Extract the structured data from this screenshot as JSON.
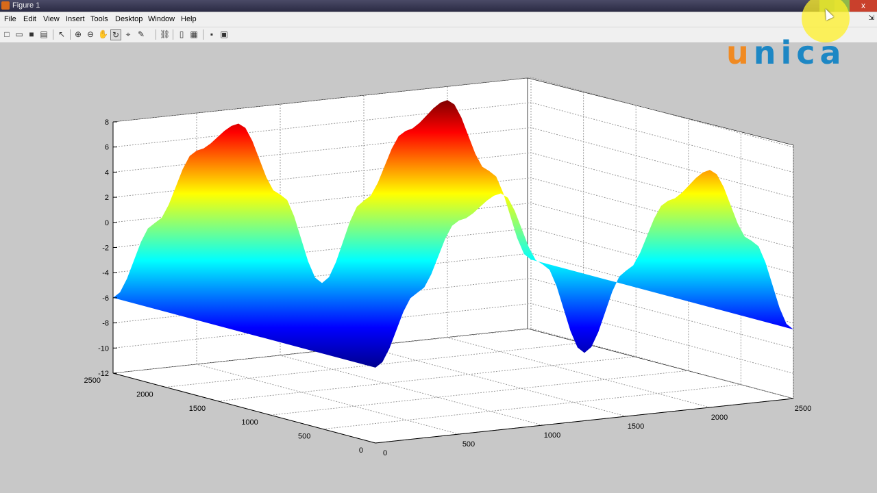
{
  "window": {
    "title": "Figure 1",
    "close_glyph": "x"
  },
  "menu": [
    "File",
    "Edit",
    "View",
    "Insert",
    "Tools",
    "Desktop",
    "Window",
    "Help"
  ],
  "menu_pin": "⇲",
  "toolbar": [
    {
      "icon": "new-figure-icon",
      "glyph": "□"
    },
    {
      "icon": "open-file-icon",
      "glyph": "▭"
    },
    {
      "icon": "save-icon",
      "glyph": "■"
    },
    {
      "icon": "print-icon",
      "glyph": "▤"
    },
    {
      "icon": "edit-plot-arrow-icon",
      "glyph": "↖"
    },
    {
      "icon": "zoom-in-icon",
      "glyph": "⊕"
    },
    {
      "icon": "zoom-out-icon",
      "glyph": "⊖"
    },
    {
      "icon": "pan-hand-icon",
      "glyph": "✋"
    },
    {
      "icon": "rotate-3d-icon",
      "glyph": "↻"
    },
    {
      "icon": "data-cursor-icon",
      "glyph": "⌖"
    },
    {
      "icon": "brush-icon",
      "glyph": "✎"
    },
    {
      "icon": "link-plot-icon",
      "glyph": "⛓"
    },
    {
      "icon": "colorbar-icon",
      "glyph": "▯"
    },
    {
      "icon": "legend-icon",
      "glyph": "▦"
    },
    {
      "icon": "hide-tools-icon",
      "glyph": "▪"
    },
    {
      "icon": "show-tools-icon",
      "glyph": "▣"
    }
  ],
  "logo": {
    "u": "u",
    "rest": "nica"
  },
  "chart_data": {
    "type": "surface",
    "colormap": "jet",
    "function": "z varies sinusoidally along x, constant along y",
    "x": [
      0,
      250,
      500,
      750,
      1000,
      1250,
      1500,
      1750,
      2000,
      2250,
      2500
    ],
    "z_profile": [
      -6,
      -0.4,
      5.0,
      6.8,
      0.8,
      -6.6,
      -0.4,
      4.8,
      6.9,
      0.9,
      -6.5
    ],
    "xlim": [
      0,
      2500
    ],
    "ylim": [
      0,
      2500
    ],
    "zlim": [
      -12,
      8
    ],
    "xticks": [
      "0",
      "500",
      "1000",
      "1500",
      "2000",
      "2500"
    ],
    "yticks": [
      "0",
      "500",
      "1000",
      "1500",
      "2000",
      "2500"
    ],
    "zticks": [
      "8",
      "6",
      "4",
      "2",
      "0",
      "-2",
      "-4",
      "-6",
      "-8",
      "-10",
      "-12"
    ],
    "grid": true,
    "view": "3-D perspective"
  }
}
